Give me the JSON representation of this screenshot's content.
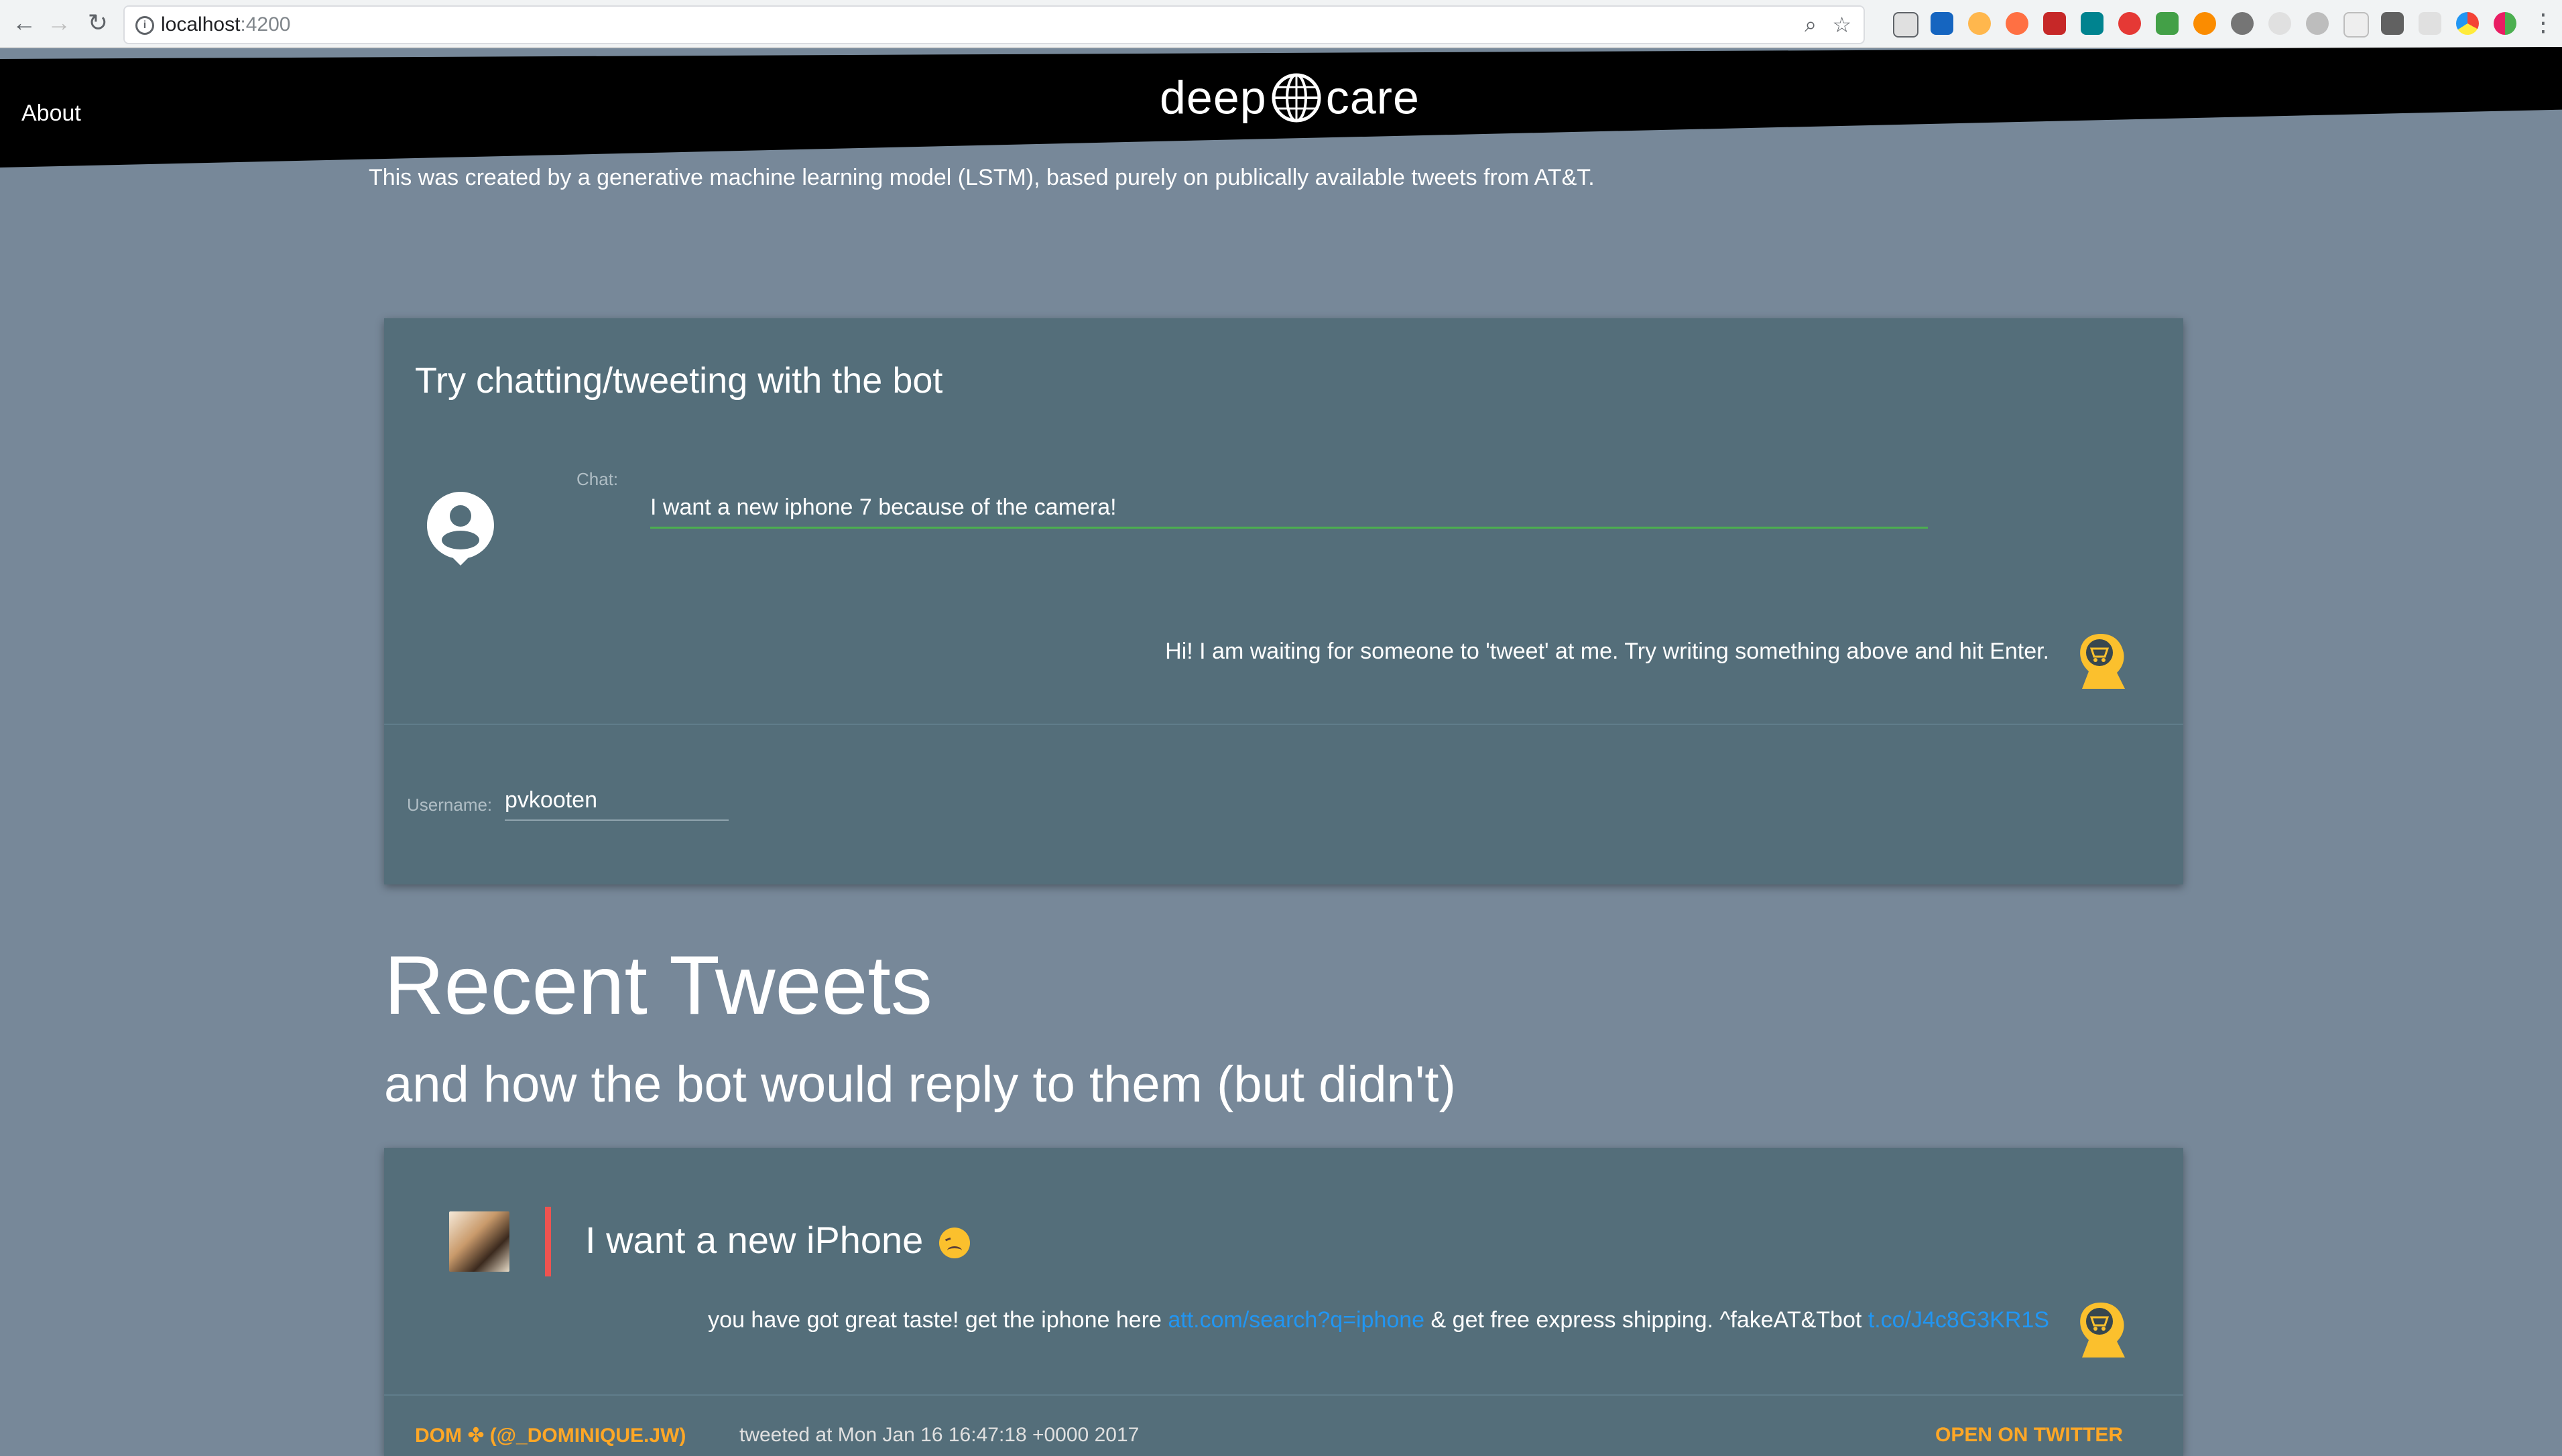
{
  "browser": {
    "url_host": "localhost",
    "url_port": ":4200"
  },
  "header": {
    "about_link": "About",
    "logo_left": "deep",
    "logo_right": "care",
    "subtitle": "This was created by a generative machine learning model (LSTM), based purely on publically available tweets from AT&T."
  },
  "chat": {
    "title": "Try chatting/tweeting with the bot",
    "chat_label": "Chat:",
    "chat_value": "I want a new iphone 7 because of the camera!",
    "bot_message": "Hi! I am waiting for someone to 'tweet' at me. Try writing something above and hit Enter.",
    "username_label": "Username:",
    "username_value": "pvkooten"
  },
  "recent": {
    "heading": "Recent Tweets",
    "subheading": "and how the bot would reply to them (but didn't)"
  },
  "tweet": {
    "text": "I want a new iPhone",
    "reply_part1": "you have got great taste! get the iphone here ",
    "reply_link1": "att.com/search?q=iphone",
    "reply_part2": " & get free express shipping. ^fakeAT&Tbot ",
    "reply_link2": "t.co/J4c8G3KR1S",
    "author": "DOM ✤ (@_DOMINIQUE.JW)",
    "tweeted_at": "tweeted at Mon Jan 16 16:47:18 +0000 2017",
    "open_on_twitter": "OPEN ON TWITTER"
  },
  "colors": {
    "page_bg": "#778899",
    "card_bg": "#546e7a",
    "accent_green": "#4caf50",
    "link_blue": "#2196f3",
    "quote_red": "#ef5350",
    "orange": "#ffa726"
  }
}
